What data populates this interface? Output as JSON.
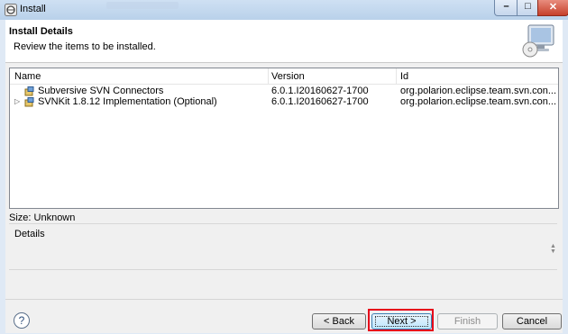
{
  "window": {
    "title": "Install",
    "title_icon": "eclipse-icon",
    "controls": {
      "minimize": "minimize-icon",
      "maximize": "maximize-icon",
      "close": "close-icon"
    }
  },
  "header": {
    "title": "Install Details",
    "subtitle": "Review the items to be installed.",
    "banner_icon": "monitor-cd-icon"
  },
  "table": {
    "columns": [
      "Name",
      "Version",
      "Id"
    ],
    "rows": [
      {
        "name": "Subversive SVN Connectors",
        "version": "6.0.1.I20160627-1700",
        "id": "org.polarion.eclipse.team.svn.con...",
        "expandable": false
      },
      {
        "name": "SVNKit 1.8.12 Implementation (Optional)",
        "version": "6.0.1.I20160627-1700",
        "id": "org.polarion.eclipse.team.svn.con...",
        "expandable": true
      }
    ]
  },
  "size_text": "Size: Unknown",
  "details_label": "Details",
  "buttons": {
    "back": "< Back",
    "next": "Next >",
    "finish": "Finish",
    "cancel": "Cancel",
    "help": "?"
  },
  "colors": {
    "highlight": "#e6001a",
    "titlebar": "#b9d1ea"
  }
}
